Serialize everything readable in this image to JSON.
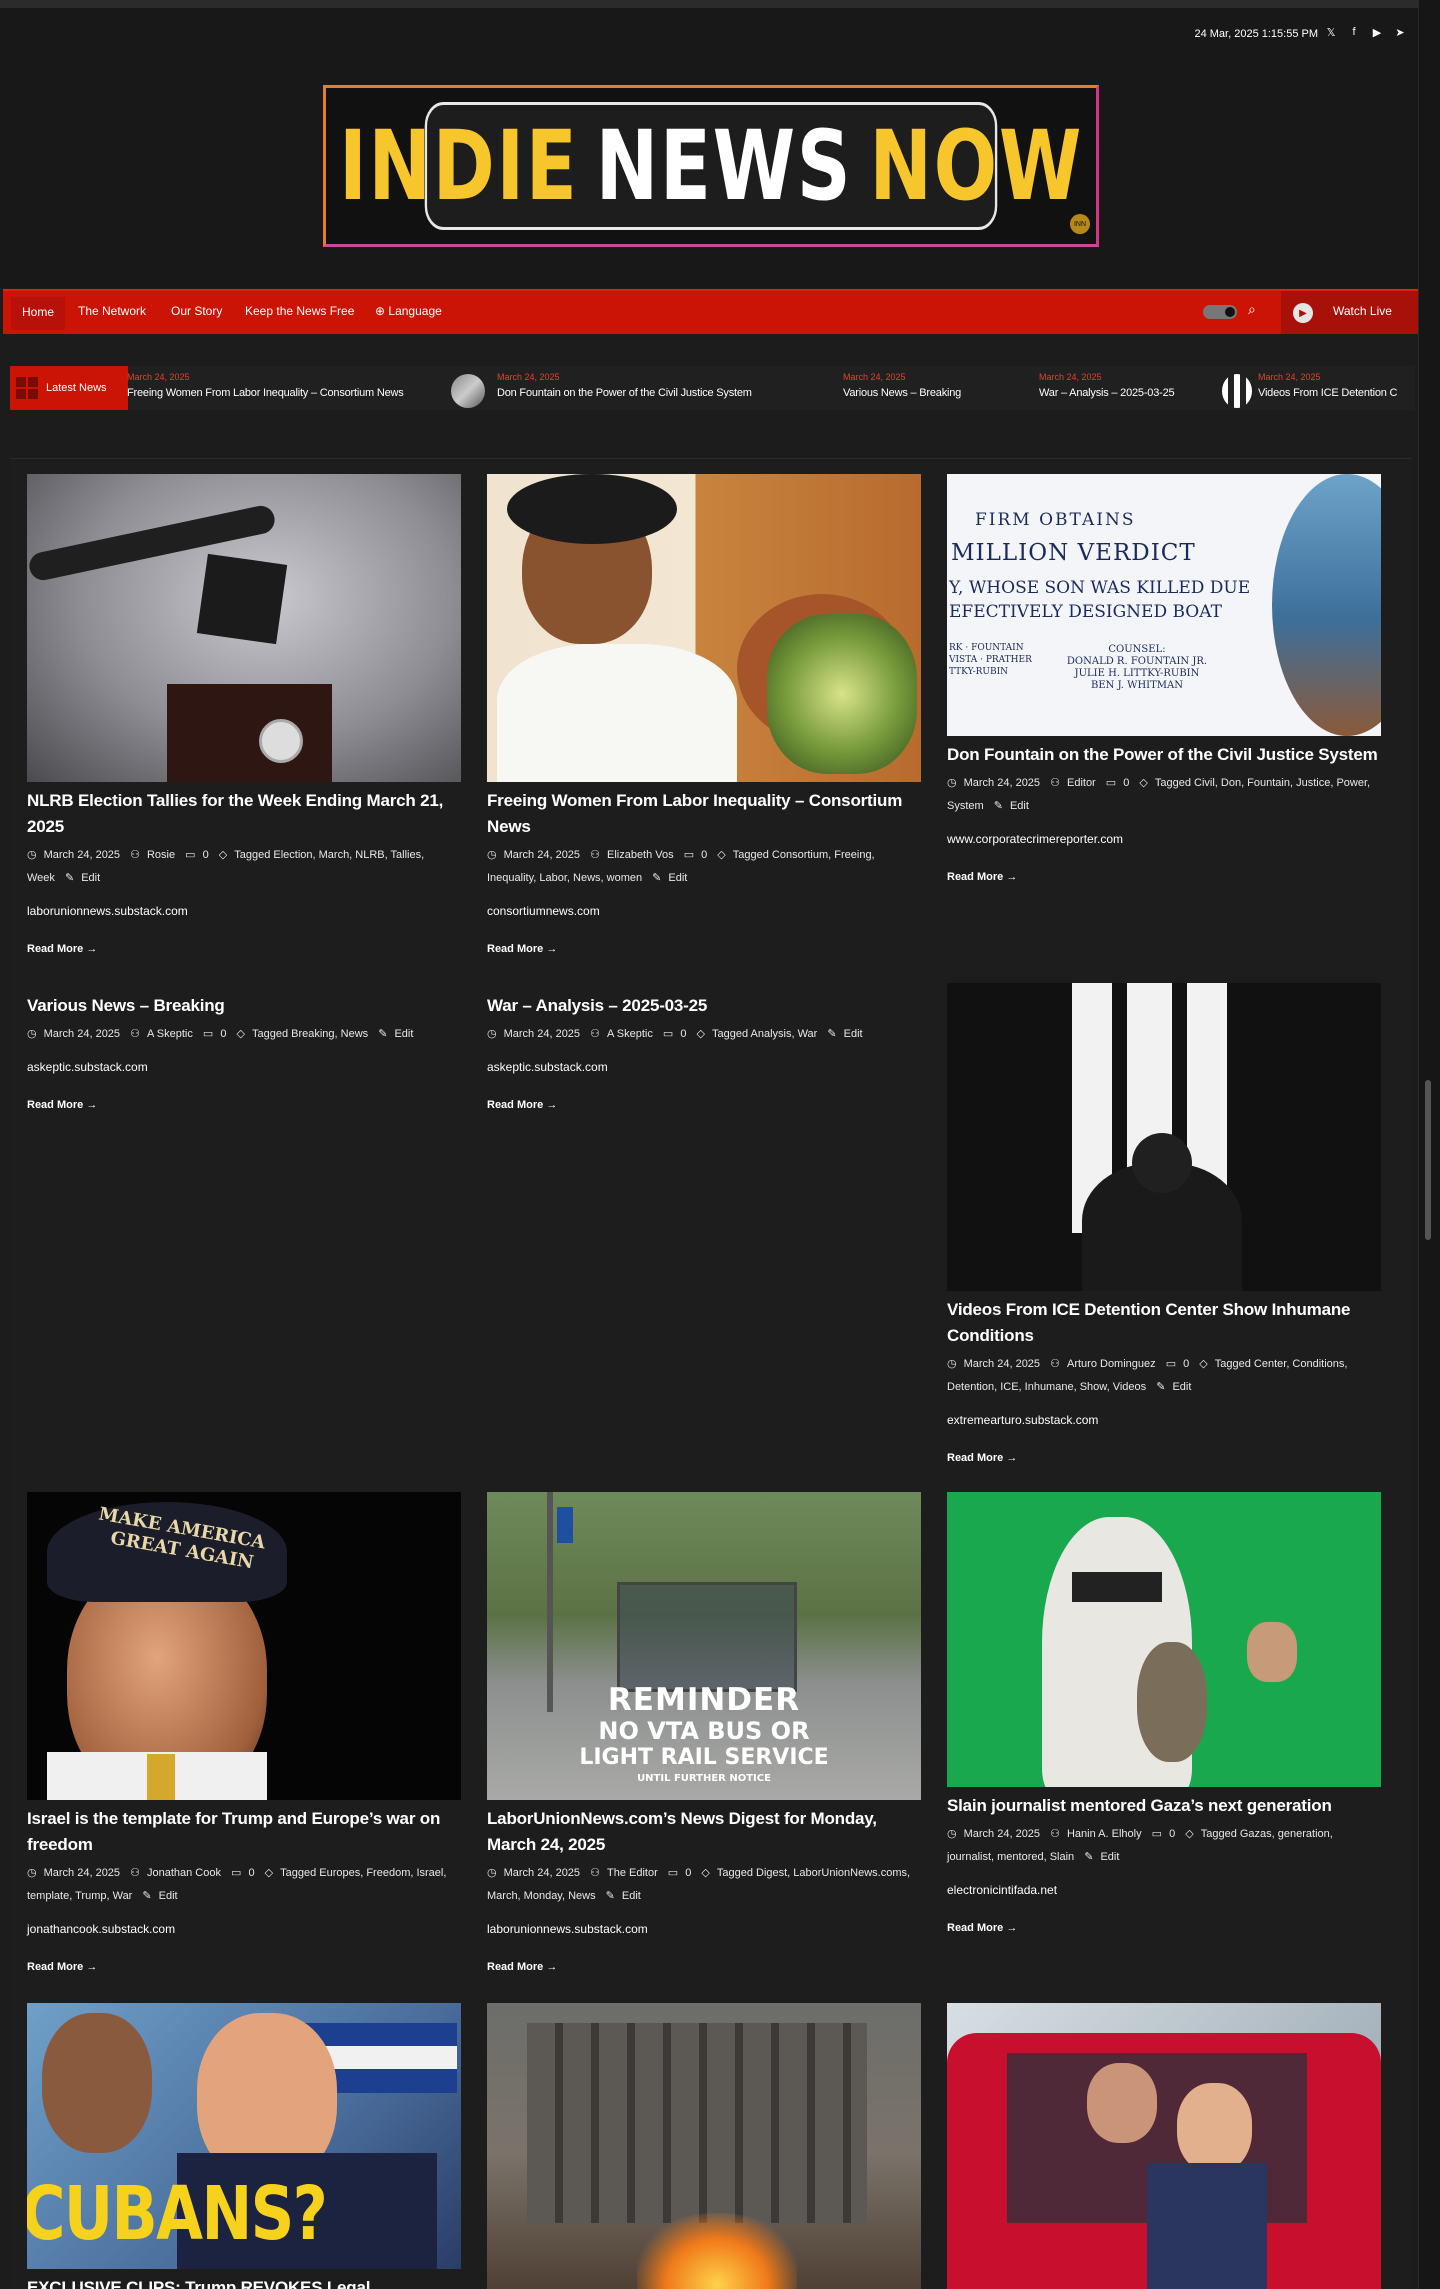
{
  "header": {
    "datetime": "24 Mar, 2025 1:15:55 PM",
    "logo_parts": [
      "INDIE",
      "NEWS",
      "NOW"
    ],
    "logo_badge": "INN",
    "socials": [
      "x-icon",
      "facebook-icon",
      "youtube-icon",
      "telegram-icon"
    ]
  },
  "nav": {
    "items": [
      "Home",
      "The Network",
      "Our Story",
      "Keep the News Free",
      "Language"
    ],
    "watch_live": "Watch Live"
  },
  "ticker": {
    "label": "Latest News",
    "items": [
      {
        "date": "March 24, 2025",
        "title": "Freeing Women From Labor Inequality – Consortium News"
      },
      {
        "date": "March 24, 2025",
        "title": "Don Fountain on the Power of the Civil Justice System"
      },
      {
        "date": "March 24, 2025",
        "title": "Various News – Breaking"
      },
      {
        "date": "March 24, 2025",
        "title": "War – Analysis – 2025-03-25"
      },
      {
        "date": "March 24, 2025",
        "title": "Videos From ICE Detention C"
      }
    ]
  },
  "posts": [
    {
      "title": "NLRB Election Tallies for the Week Ending March 21, 2025",
      "date": "March 24, 2025",
      "author": "Rosie",
      "comments": "0",
      "tags": "Tagged Election, March, NLRB, Tallies, Week",
      "edit": "Edit",
      "source": "laborunionnews.substack.com",
      "more": "Read More"
    },
    {
      "title": "Freeing Women From Labor Inequality – Consortium News",
      "date": "March 24, 2025",
      "author": "Elizabeth Vos",
      "comments": "0",
      "tags": "Tagged Consortium, Freeing, Inequality, Labor, News, women",
      "edit": "Edit",
      "source": "consortiumnews.com",
      "more": "Read More"
    },
    {
      "title": "Don Fountain on the Power of the Civil Justice System",
      "date": "March 24, 2025",
      "author": "Editor",
      "comments": "0",
      "tags": "Tagged Civil, Don, Fountain, Justice, Power, System",
      "edit": "Edit",
      "source": "www.corporatecrimereporter.com",
      "more": "Read More"
    },
    {
      "title": "Various News – Breaking",
      "date": "March 24, 2025",
      "author": "A Skeptic",
      "comments": "0",
      "tags": "Tagged Breaking, News",
      "edit": "Edit",
      "source": "askeptic.substack.com",
      "more": "Read More"
    },
    {
      "title": "War – Analysis – 2025-03-25",
      "date": "March 24, 2025",
      "author": "A Skeptic",
      "comments": "0",
      "tags": "Tagged Analysis, War",
      "edit": "Edit",
      "source": "askeptic.substack.com",
      "more": "Read More"
    },
    {
      "title": "Videos From ICE Detention Center Show Inhumane Conditions",
      "date": "March 24, 2025",
      "author": "Arturo Dominguez",
      "comments": "0",
      "tags": "Tagged Center, Conditions, Detention, ICE, Inhumane, Show, Videos",
      "edit": "Edit",
      "source": "extremearturo.substack.com",
      "more": "Read More"
    },
    {
      "title": "Israel is the template for Trump and Europe’s war on freedom",
      "date": "March 24, 2025",
      "author": "Jonathan Cook",
      "comments": "0",
      "tags": "Tagged Europes, Freedom, Israel, template, Trump, War",
      "edit": "Edit",
      "source": "jonathancook.substack.com",
      "more": "Read More"
    },
    {
      "title": "LaborUnionNews.com’s News Digest for Monday, March 24, 2025",
      "date": "March 24, 2025",
      "author": "The Editor",
      "comments": "0",
      "tags": "Tagged Digest, LaborUnionNews.coms, March, Monday, News",
      "edit": "Edit",
      "source": "laborunionnews.substack.com",
      "more": "Read More"
    },
    {
      "title": "Slain journalist mentored Gaza’s next generation",
      "date": "March 24, 2025",
      "author": "Hanin A. Elholy",
      "comments": "0",
      "tags": "Tagged Gazas, generation, journalist, mentored, Slain",
      "edit": "Edit",
      "source": "electronicintifada.net",
      "more": "Read More"
    },
    {
      "title": "EXCLUSIVE CLIPS: Trump REVOKES Legal",
      "date": "",
      "author": "",
      "comments": "",
      "tags": "",
      "edit": "",
      "source": "",
      "more": ""
    }
  ],
  "image_text": {
    "verdict": [
      "FIRM OBTAINS",
      "MILLION VERDICT",
      "Y, WHOSE SON WAS KILLED DUE",
      "EFECTIVELY DESIGNED BOAT",
      "COUNSEL:",
      "DONALD R. FOUNTAIN JR.",
      "JULIE H. LITTKY-RUBIN",
      "BEN J. WHITMAN",
      "RK · FOUNTAIN",
      "VISTA · PRATHER",
      "TTKY-RUBIN"
    ],
    "hat": [
      "MAKE AMERICA",
      "GREAT AGAIN"
    ],
    "bus": [
      "REMINDER",
      "NO VTA BUS OR",
      "LIGHT RAIL SERVICE",
      "UNTIL FURTHER NOTICE"
    ],
    "cubans": "CUBANS?"
  }
}
